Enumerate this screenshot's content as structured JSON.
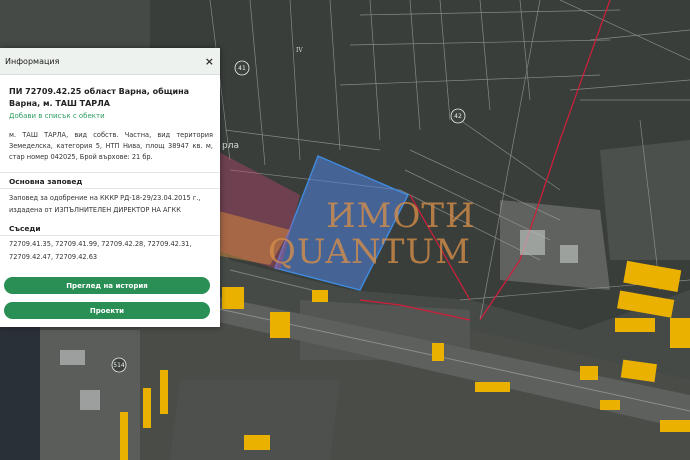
{
  "panel": {
    "header_title": "Информация",
    "close_symbol": "×",
    "parcel_title": "ПИ 72709.42.25 област Варна, община Варна, м. ТАШ ТАРЛА",
    "add_to_list_link": "Добави в списък с обекти",
    "description": "м. ТАШ ТАРЛА, вид собств. Частна, вид територия Земеделска, категория 5, НТП Нива, площ 38947 кв. м, стар номер 042025, Брой върхове: 21 бр.",
    "order_heading": "Основна заповед",
    "order_text": "Заповед за одобрение на КККР РД-18-29/23.04.2015 г., издадена от ИЗПЪЛНИТЕЛЕН ДИРЕКТОР НА АГКК",
    "neighbors_heading": "Съседи",
    "neighbors_text": "72709.41.35, 72709.41.99, 72709.42.28, 72709.42.31, 72709.42.47, 72709.42.63",
    "history_button": "Преглед на история",
    "projects_button": "Проекти"
  },
  "map": {
    "labels": {
      "road_41": "41",
      "road_42": "42",
      "road_514": "514",
      "sector_iv": "IV",
      "street_fragment": "рла"
    },
    "highlight_color": "#3f8be0",
    "boundary_color": "#d21e3a",
    "building_color": "#eab100"
  },
  "watermark": {
    "line1": "ИМОТИ",
    "line2": "QUANTUM"
  }
}
